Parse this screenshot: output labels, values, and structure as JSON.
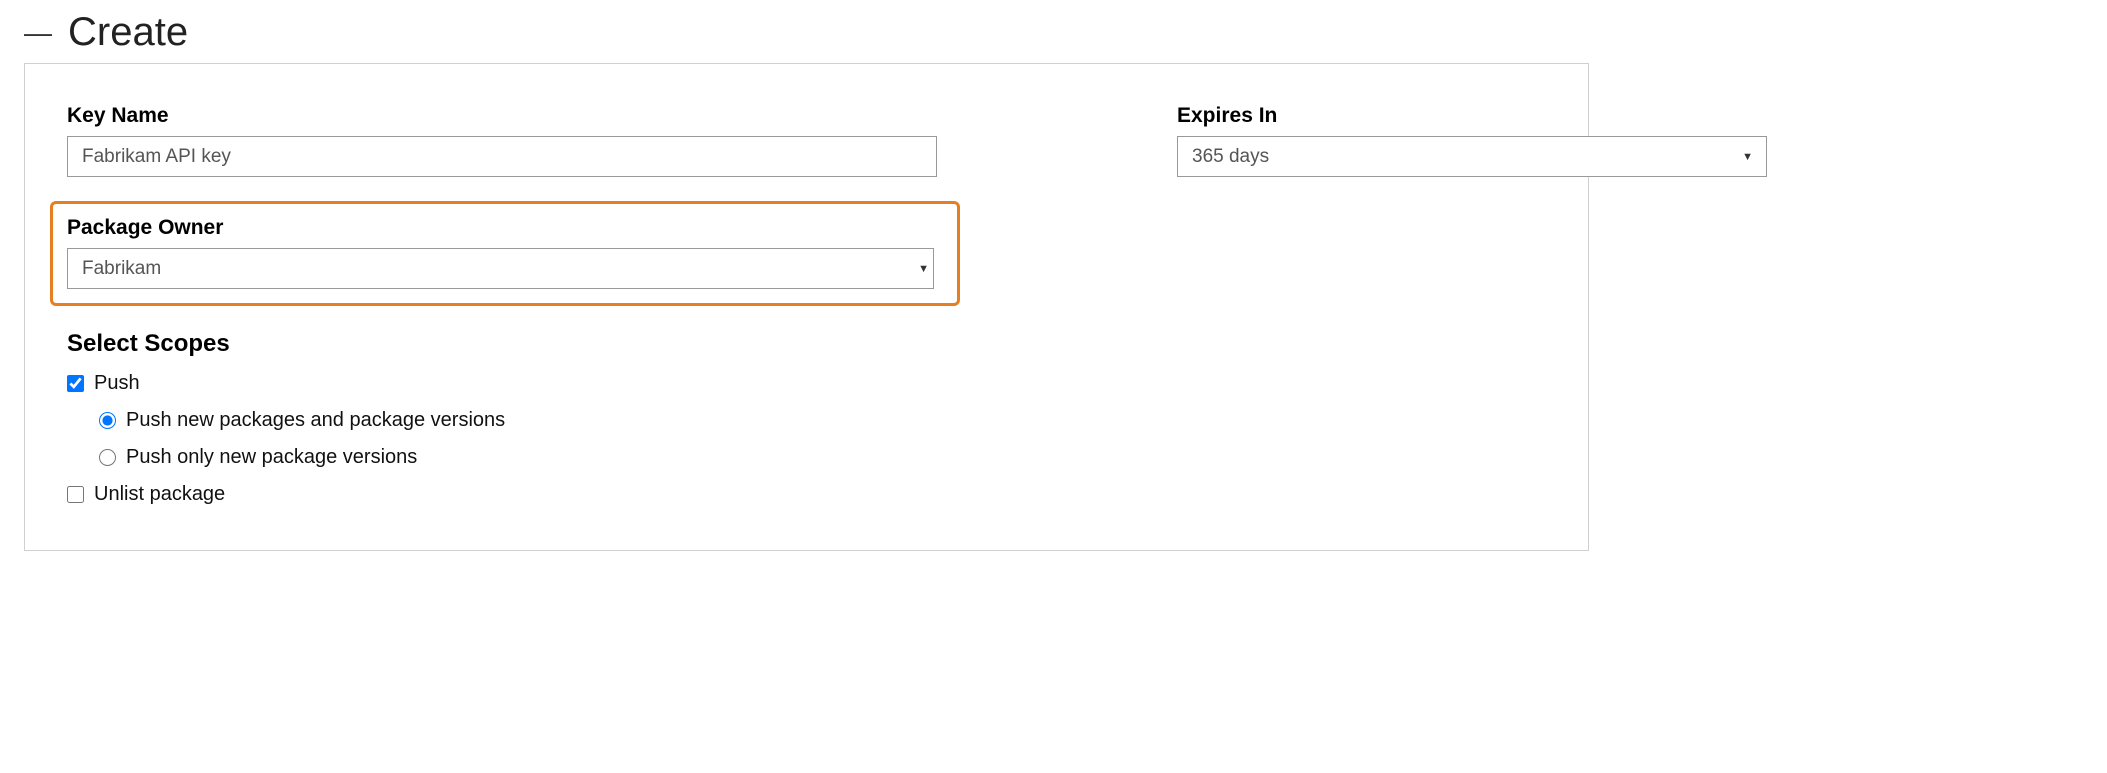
{
  "section": {
    "title": "Create"
  },
  "form": {
    "keyName": {
      "label": "Key Name",
      "value": "Fabrikam API key"
    },
    "expiresIn": {
      "label": "Expires In",
      "value": "365 days"
    },
    "packageOwner": {
      "label": "Package Owner",
      "value": "Fabrikam"
    }
  },
  "scopes": {
    "heading": "Select Scopes",
    "push": {
      "label": "Push",
      "checked": true,
      "options": {
        "newAndVersions": {
          "label": "Push new packages and package versions",
          "checked": true
        },
        "versionsOnly": {
          "label": "Push only new package versions",
          "checked": false
        }
      }
    },
    "unlist": {
      "label": "Unlist package",
      "checked": false
    }
  }
}
